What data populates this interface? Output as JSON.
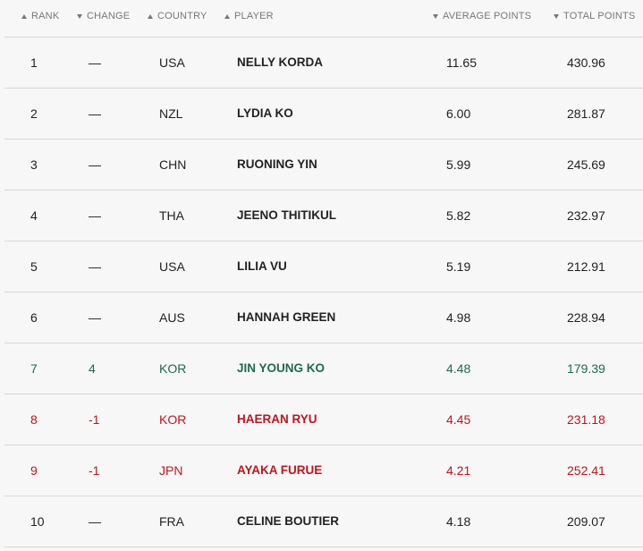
{
  "colors": {
    "up": "#1e6b4c",
    "down": "#c0151b",
    "neutral": "#222222",
    "header": "#777777"
  },
  "header": {
    "rank": {
      "label": "RANK",
      "arrow": "up"
    },
    "change": {
      "label": "CHANGE",
      "arrow": "down"
    },
    "country": {
      "label": "COUNTRY",
      "arrow": "up"
    },
    "player": {
      "label": "PLAYER",
      "arrow": "up"
    },
    "avg": {
      "label": "AVERAGE POINTS",
      "arrow": "down"
    },
    "total": {
      "label": "TOTAL POINTS",
      "arrow": "down"
    }
  },
  "rows": [
    {
      "rank": "1",
      "change": "—",
      "country": "USA",
      "player": "NELLY KORDA",
      "avg": "11.65",
      "total": "430.96",
      "trend": "none"
    },
    {
      "rank": "2",
      "change": "—",
      "country": "NZL",
      "player": "LYDIA KO",
      "avg": "6.00",
      "total": "281.87",
      "trend": "none"
    },
    {
      "rank": "3",
      "change": "—",
      "country": "CHN",
      "player": "RUONING YIN",
      "avg": "5.99",
      "total": "245.69",
      "trend": "none"
    },
    {
      "rank": "4",
      "change": "—",
      "country": "THA",
      "player": "JEENO THITIKUL",
      "avg": "5.82",
      "total": "232.97",
      "trend": "none"
    },
    {
      "rank": "5",
      "change": "—",
      "country": "USA",
      "player": "LILIA VU",
      "avg": "5.19",
      "total": "212.91",
      "trend": "none"
    },
    {
      "rank": "6",
      "change": "—",
      "country": "AUS",
      "player": "HANNAH GREEN",
      "avg": "4.98",
      "total": "228.94",
      "trend": "none"
    },
    {
      "rank": "7",
      "change": "4",
      "country": "KOR",
      "player": "JIN YOUNG KO",
      "avg": "4.48",
      "total": "179.39",
      "trend": "up"
    },
    {
      "rank": "8",
      "change": "-1",
      "country": "KOR",
      "player": "HAERAN RYU",
      "avg": "4.45",
      "total": "231.18",
      "trend": "down"
    },
    {
      "rank": "9",
      "change": "-1",
      "country": "JPN",
      "player": "AYAKA FURUE",
      "avg": "4.21",
      "total": "252.41",
      "trend": "down"
    },
    {
      "rank": "10",
      "change": "—",
      "country": "FRA",
      "player": "CELINE BOUTIER",
      "avg": "4.18",
      "total": "209.07",
      "trend": "none"
    }
  ]
}
